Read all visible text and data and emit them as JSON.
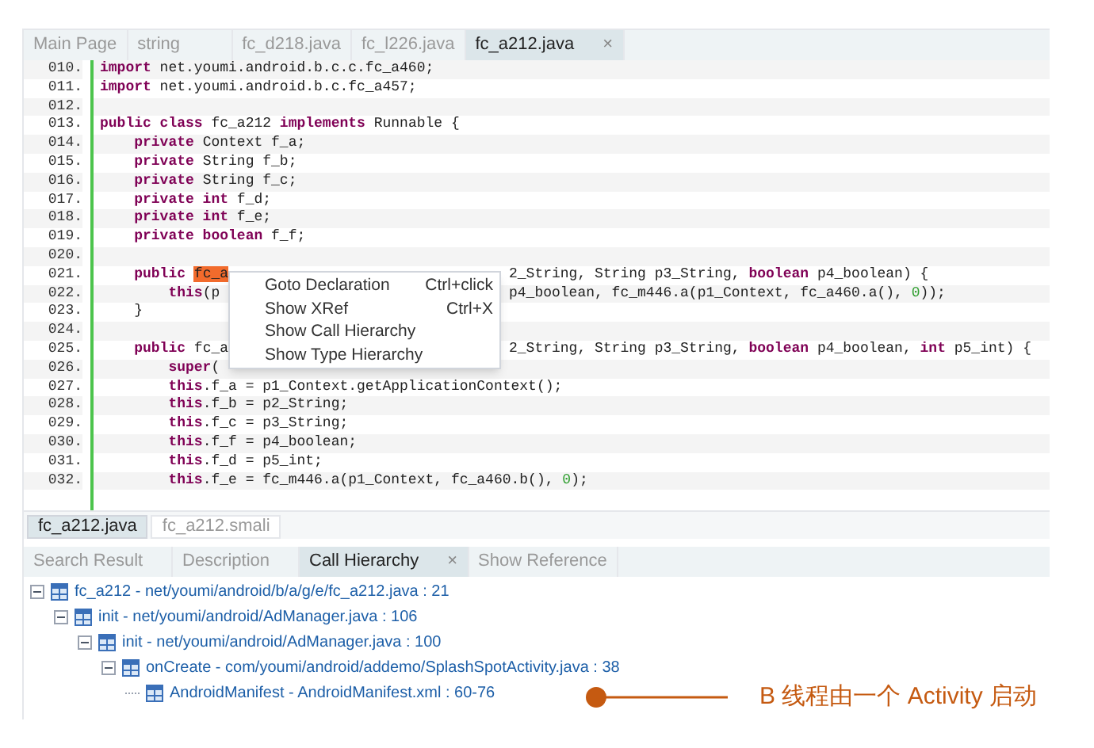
{
  "editor_tabs": [
    {
      "label": "Main Page",
      "selected": false
    },
    {
      "label": "string",
      "selected": false
    },
    {
      "label": "fc_d218.java",
      "selected": false
    },
    {
      "label": "fc_l226.java",
      "selected": false
    },
    {
      "label": "fc_a212.java",
      "selected": true,
      "close": "×"
    }
  ],
  "code_lines": [
    {
      "number": "010.",
      "tokens": [
        {
          "kind": "kw",
          "text": "import"
        },
        {
          "kind": "plain",
          "text": " net.youmi.android.b.c.c.fc_a460;"
        }
      ]
    },
    {
      "number": "011.",
      "tokens": [
        {
          "kind": "kw",
          "text": "import"
        },
        {
          "kind": "plain",
          "text": " net.youmi.android.b.c.fc_a457;"
        }
      ]
    },
    {
      "number": "012."
    },
    {
      "number": "013.",
      "tokens": [
        {
          "kind": "kw",
          "text": "public class"
        },
        {
          "kind": "plain",
          "text": " fc_a212 "
        },
        {
          "kind": "kw",
          "text": "implements"
        },
        {
          "kind": "plain",
          "text": " Runnable {"
        }
      ]
    },
    {
      "number": "014.",
      "tokens": [
        {
          "kind": "kw",
          "text": "    private"
        },
        {
          "kind": "plain",
          "text": " Context f_a;"
        }
      ]
    },
    {
      "number": "015.",
      "tokens": [
        {
          "kind": "kw",
          "text": "    private"
        },
        {
          "kind": "plain",
          "text": " String f_b;"
        }
      ]
    },
    {
      "number": "016.",
      "tokens": [
        {
          "kind": "kw",
          "text": "    private"
        },
        {
          "kind": "plain",
          "text": " String f_c;"
        }
      ]
    },
    {
      "number": "017.",
      "tokens": [
        {
          "kind": "kw",
          "text": "    private int"
        },
        {
          "kind": "plain",
          "text": " f_d;"
        }
      ]
    },
    {
      "number": "018.",
      "tokens": [
        {
          "kind": "kw",
          "text": "    private int"
        },
        {
          "kind": "plain",
          "text": " f_e;"
        }
      ]
    },
    {
      "number": "019.",
      "tokens": [
        {
          "kind": "kw",
          "text": "    private boolean"
        },
        {
          "kind": "plain",
          "text": " f_f;"
        }
      ]
    },
    {
      "number": "020."
    },
    {
      "number": "021.",
      "tokens": [
        {
          "kind": "kw",
          "text": "    public "
        },
        {
          "kind": "match",
          "text": "fc_a"
        }
      ],
      "tokens_after_menu": [
        {
          "kind": "plain",
          "text": "2_String, String p3_String, "
        },
        {
          "kind": "kw",
          "text": "boolean"
        },
        {
          "kind": "plain",
          "text": " p4_boolean) {"
        }
      ]
    },
    {
      "number": "022.",
      "tokens": [
        {
          "kind": "kw",
          "text": "        this"
        },
        {
          "kind": "plain",
          "text": "(p"
        }
      ],
      "tokens_after_menu": [
        {
          "kind": "plain",
          "text": "p4_boolean, fc_m446.a(p1_Context, fc_a460.a(), "
        },
        {
          "kind": "num",
          "text": "0"
        },
        {
          "kind": "plain",
          "text": "));"
        }
      ]
    },
    {
      "number": "023.",
      "tokens": [
        {
          "kind": "plain",
          "text": "    }"
        }
      ]
    },
    {
      "number": "024."
    },
    {
      "number": "025.",
      "tokens": [
        {
          "kind": "kw",
          "text": "    public"
        },
        {
          "kind": "plain",
          "text": " fc_a"
        }
      ],
      "tokens_after_menu": [
        {
          "kind": "plain",
          "text": "2_String, String p3_String, "
        },
        {
          "kind": "kw",
          "text": "boolean"
        },
        {
          "kind": "plain",
          "text": " p4_boolean, "
        },
        {
          "kind": "kw",
          "text": "int"
        },
        {
          "kind": "plain",
          "text": " p5_int) {"
        }
      ]
    },
    {
      "number": "026.",
      "tokens": [
        {
          "kind": "kw",
          "text": "        super"
        },
        {
          "kind": "plain",
          "text": "("
        }
      ]
    },
    {
      "number": "027.",
      "tokens": [
        {
          "kind": "kw",
          "text": "        this"
        },
        {
          "kind": "plain",
          "text": ".f_a = p1_Context.getApplicationContext();"
        }
      ]
    },
    {
      "number": "028.",
      "tokens": [
        {
          "kind": "kw",
          "text": "        this"
        },
        {
          "kind": "plain",
          "text": ".f_b = p2_String;"
        }
      ]
    },
    {
      "number": "029.",
      "tokens": [
        {
          "kind": "kw",
          "text": "        this"
        },
        {
          "kind": "plain",
          "text": ".f_c = p3_String;"
        }
      ]
    },
    {
      "number": "030.",
      "tokens": [
        {
          "kind": "kw",
          "text": "        this"
        },
        {
          "kind": "plain",
          "text": ".f_f = p4_boolean;"
        }
      ]
    },
    {
      "number": "031.",
      "tokens": [
        {
          "kind": "kw",
          "text": "        this"
        },
        {
          "kind": "plain",
          "text": ".f_d = p5_int;"
        }
      ]
    },
    {
      "number": "032.",
      "tokens": [
        {
          "kind": "kw",
          "text": "        this"
        },
        {
          "kind": "plain",
          "text": ".f_e = fc_m446.a(p1_Context, fc_a460.b(), "
        },
        {
          "kind": "num",
          "text": "0"
        },
        {
          "kind": "plain",
          "text": ");"
        }
      ]
    }
  ],
  "context_menu": [
    {
      "label": "Goto Declaration",
      "shortcut": "Ctrl+click"
    },
    {
      "label": "Show XRef",
      "shortcut": "Ctrl+X"
    },
    {
      "label": "Show Call Hierarchy"
    },
    {
      "label": "Show Type Hierarchy"
    }
  ],
  "view_tabs": [
    {
      "label": "fc_a212.java",
      "selected": true
    },
    {
      "label": "fc_a212.smali",
      "selected": false
    }
  ],
  "panel_tabs": [
    {
      "label": "Search Result",
      "selected": false
    },
    {
      "label": "Description",
      "selected": false
    },
    {
      "label": "Call Hierarchy",
      "selected": true,
      "close": "×"
    },
    {
      "label": "Show Reference",
      "selected": false
    }
  ],
  "call_tree": [
    {
      "label": "fc_a212 - net/youmi/android/b/a/g/e/fc_a212.java : 21",
      "expanded": true,
      "children": [
        {
          "label": "init - net/youmi/android/AdManager.java : 106",
          "expanded": true,
          "children": [
            {
              "label": "init - net/youmi/android/AdManager.java : 100",
              "expanded": true,
              "children": [
                {
                  "label": "onCreate - com/youmi/android/addemo/SplashSpotActivity.java : 38",
                  "expanded": true,
                  "children": [
                    {
                      "label": "AndroidManifest - AndroidManifest.xml : 60-76",
                      "expanded": false
                    }
                  ]
                }
              ]
            }
          ]
        }
      ]
    }
  ],
  "annotation": {
    "text": "B 线程由一个 Activity 启动",
    "color": "#c55a11"
  }
}
